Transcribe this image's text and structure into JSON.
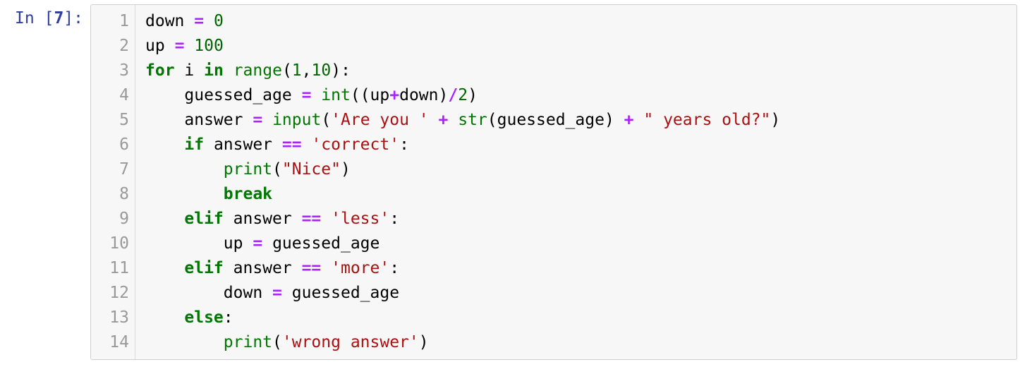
{
  "prompt": {
    "label": "In",
    "open_bracket": " [",
    "number": "7",
    "close_bracket": "]:"
  },
  "code": {
    "line_numbers": [
      "1",
      "2",
      "3",
      "4",
      "5",
      "6",
      "7",
      "8",
      "9",
      "10",
      "11",
      "12",
      "13",
      "14"
    ],
    "lines": [
      [
        {
          "cls": "tok-name",
          "t": "down"
        },
        {
          "cls": "tok-punct",
          "t": " "
        },
        {
          "cls": "tok-op",
          "t": "="
        },
        {
          "cls": "tok-punct",
          "t": " "
        },
        {
          "cls": "tok-num",
          "t": "0"
        }
      ],
      [
        {
          "cls": "tok-name",
          "t": "up"
        },
        {
          "cls": "tok-punct",
          "t": " "
        },
        {
          "cls": "tok-op",
          "t": "="
        },
        {
          "cls": "tok-punct",
          "t": " "
        },
        {
          "cls": "tok-num",
          "t": "100"
        }
      ],
      [
        {
          "cls": "tok-kw",
          "t": "for"
        },
        {
          "cls": "tok-punct",
          "t": " "
        },
        {
          "cls": "tok-name",
          "t": "i"
        },
        {
          "cls": "tok-punct",
          "t": " "
        },
        {
          "cls": "tok-kw",
          "t": "in"
        },
        {
          "cls": "tok-punct",
          "t": " "
        },
        {
          "cls": "tok-builtin",
          "t": "range"
        },
        {
          "cls": "tok-punct",
          "t": "("
        },
        {
          "cls": "tok-num",
          "t": "1"
        },
        {
          "cls": "tok-punct",
          "t": ","
        },
        {
          "cls": "tok-num",
          "t": "10"
        },
        {
          "cls": "tok-punct",
          "t": "):"
        }
      ],
      [
        {
          "cls": "tok-punct",
          "t": "    "
        },
        {
          "cls": "tok-name",
          "t": "guessed_age"
        },
        {
          "cls": "tok-punct",
          "t": " "
        },
        {
          "cls": "tok-op",
          "t": "="
        },
        {
          "cls": "tok-punct",
          "t": " "
        },
        {
          "cls": "tok-builtin",
          "t": "int"
        },
        {
          "cls": "tok-punct",
          "t": "((up"
        },
        {
          "cls": "tok-op",
          "t": "+"
        },
        {
          "cls": "tok-punct",
          "t": "down)"
        },
        {
          "cls": "tok-op",
          "t": "/"
        },
        {
          "cls": "tok-num",
          "t": "2"
        },
        {
          "cls": "tok-punct",
          "t": ")"
        }
      ],
      [
        {
          "cls": "tok-punct",
          "t": "    "
        },
        {
          "cls": "tok-name",
          "t": "answer"
        },
        {
          "cls": "tok-punct",
          "t": " "
        },
        {
          "cls": "tok-op",
          "t": "="
        },
        {
          "cls": "tok-punct",
          "t": " "
        },
        {
          "cls": "tok-builtin",
          "t": "input"
        },
        {
          "cls": "tok-punct",
          "t": "("
        },
        {
          "cls": "tok-str",
          "t": "'Are you '"
        },
        {
          "cls": "tok-punct",
          "t": " "
        },
        {
          "cls": "tok-op",
          "t": "+"
        },
        {
          "cls": "tok-punct",
          "t": " "
        },
        {
          "cls": "tok-builtin",
          "t": "str"
        },
        {
          "cls": "tok-punct",
          "t": "(guessed_age) "
        },
        {
          "cls": "tok-op",
          "t": "+"
        },
        {
          "cls": "tok-punct",
          "t": " "
        },
        {
          "cls": "tok-str",
          "t": "\" years old?\""
        },
        {
          "cls": "tok-punct",
          "t": ")"
        }
      ],
      [
        {
          "cls": "tok-punct",
          "t": "    "
        },
        {
          "cls": "tok-kw",
          "t": "if"
        },
        {
          "cls": "tok-punct",
          "t": " answer "
        },
        {
          "cls": "tok-op",
          "t": "=="
        },
        {
          "cls": "tok-punct",
          "t": " "
        },
        {
          "cls": "tok-str",
          "t": "'correct'"
        },
        {
          "cls": "tok-punct",
          "t": ":"
        }
      ],
      [
        {
          "cls": "tok-punct",
          "t": "        "
        },
        {
          "cls": "tok-builtin",
          "t": "print"
        },
        {
          "cls": "tok-punct",
          "t": "("
        },
        {
          "cls": "tok-str",
          "t": "\"Nice\""
        },
        {
          "cls": "tok-punct",
          "t": ")"
        }
      ],
      [
        {
          "cls": "tok-punct",
          "t": "        "
        },
        {
          "cls": "tok-kw",
          "t": "break"
        }
      ],
      [
        {
          "cls": "tok-punct",
          "t": "    "
        },
        {
          "cls": "tok-kw",
          "t": "elif"
        },
        {
          "cls": "tok-punct",
          "t": " answer "
        },
        {
          "cls": "tok-op",
          "t": "=="
        },
        {
          "cls": "tok-punct",
          "t": " "
        },
        {
          "cls": "tok-str",
          "t": "'less'"
        },
        {
          "cls": "tok-punct",
          "t": ":"
        }
      ],
      [
        {
          "cls": "tok-punct",
          "t": "        "
        },
        {
          "cls": "tok-name",
          "t": "up"
        },
        {
          "cls": "tok-punct",
          "t": " "
        },
        {
          "cls": "tok-op",
          "t": "="
        },
        {
          "cls": "tok-punct",
          "t": " "
        },
        {
          "cls": "tok-name",
          "t": "guessed_age"
        }
      ],
      [
        {
          "cls": "tok-punct",
          "t": "    "
        },
        {
          "cls": "tok-kw",
          "t": "elif"
        },
        {
          "cls": "tok-punct",
          "t": " answer "
        },
        {
          "cls": "tok-op",
          "t": "=="
        },
        {
          "cls": "tok-punct",
          "t": " "
        },
        {
          "cls": "tok-str",
          "t": "'more'"
        },
        {
          "cls": "tok-punct",
          "t": ":"
        }
      ],
      [
        {
          "cls": "tok-punct",
          "t": "        "
        },
        {
          "cls": "tok-name",
          "t": "down"
        },
        {
          "cls": "tok-punct",
          "t": " "
        },
        {
          "cls": "tok-op",
          "t": "="
        },
        {
          "cls": "tok-punct",
          "t": " "
        },
        {
          "cls": "tok-name",
          "t": "guessed_age"
        }
      ],
      [
        {
          "cls": "tok-punct",
          "t": "    "
        },
        {
          "cls": "tok-kw",
          "t": "else"
        },
        {
          "cls": "tok-punct",
          "t": ":"
        }
      ],
      [
        {
          "cls": "tok-punct",
          "t": "        "
        },
        {
          "cls": "tok-builtin",
          "t": "print"
        },
        {
          "cls": "tok-punct",
          "t": "("
        },
        {
          "cls": "tok-str",
          "t": "'wrong answer'"
        },
        {
          "cls": "tok-punct",
          "t": ")"
        }
      ]
    ]
  }
}
